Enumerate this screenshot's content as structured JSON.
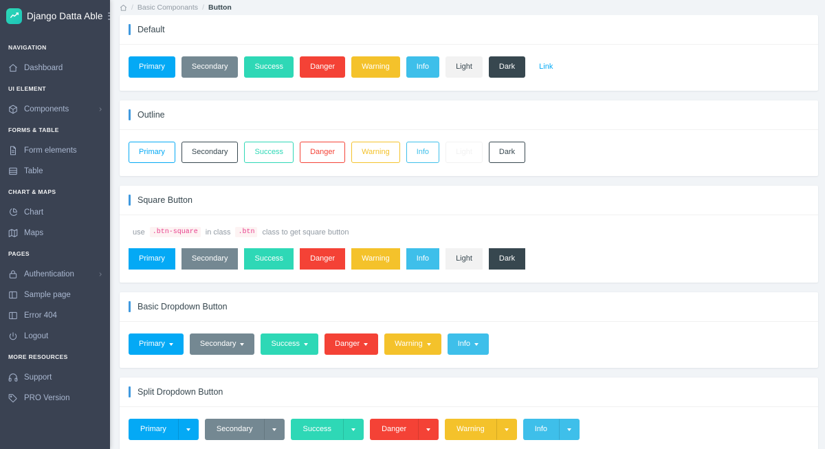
{
  "sidebar": {
    "brand": "Django Datta Able",
    "logo_icon": "trending-up-icon",
    "toggle_icon": "menu-toggle-icon",
    "groups": [
      {
        "caption": "NAVIGATION",
        "items": [
          {
            "label": "Dashboard",
            "icon": "home-icon",
            "has_arrow": false
          }
        ]
      },
      {
        "caption": "UI ELEMENT",
        "items": [
          {
            "label": "Components",
            "icon": "box-icon",
            "has_arrow": true
          }
        ]
      },
      {
        "caption": "FORMS & TABLE",
        "items": [
          {
            "label": "Form elements",
            "icon": "file-text-icon",
            "has_arrow": false
          },
          {
            "label": "Table",
            "icon": "table-icon",
            "has_arrow": false
          }
        ]
      },
      {
        "caption": "CHART & MAPS",
        "items": [
          {
            "label": "Chart",
            "icon": "pie-chart-icon",
            "has_arrow": false
          },
          {
            "label": "Maps",
            "icon": "map-icon",
            "has_arrow": false
          }
        ]
      },
      {
        "caption": "PAGES",
        "items": [
          {
            "label": "Authentication",
            "icon": "lock-icon",
            "has_arrow": true
          },
          {
            "label": "Sample page",
            "icon": "sidebar-page-icon",
            "has_arrow": false
          },
          {
            "label": "Error 404",
            "icon": "sidebar-page-icon",
            "has_arrow": false
          },
          {
            "label": "Logout",
            "icon": "power-icon",
            "has_arrow": false
          }
        ]
      },
      {
        "caption": "MORE RESOURCES",
        "items": [
          {
            "label": "Support",
            "icon": "headphones-icon",
            "has_arrow": false
          },
          {
            "label": "PRO Version",
            "icon": "tag-icon",
            "has_arrow": false
          }
        ]
      }
    ]
  },
  "breadcrumb": {
    "home_icon": "home-icon",
    "separator": "/",
    "parent": "Basic Componants",
    "current": "Button"
  },
  "sections": {
    "default": {
      "title": "Default",
      "buttons": [
        {
          "label": "Primary",
          "variant": "primary"
        },
        {
          "label": "Secondary",
          "variant": "secondary"
        },
        {
          "label": "Success",
          "variant": "success"
        },
        {
          "label": "Danger",
          "variant": "danger"
        },
        {
          "label": "Warning",
          "variant": "warning"
        },
        {
          "label": "Info",
          "variant": "info"
        },
        {
          "label": "Light",
          "variant": "light"
        },
        {
          "label": "Dark",
          "variant": "dark"
        },
        {
          "label": "Link",
          "variant": "link"
        }
      ]
    },
    "outline": {
      "title": "Outline",
      "buttons": [
        {
          "label": "Primary",
          "variant": "primary"
        },
        {
          "label": "Secondary",
          "variant": "secondary"
        },
        {
          "label": "Success",
          "variant": "success"
        },
        {
          "label": "Danger",
          "variant": "danger"
        },
        {
          "label": "Warning",
          "variant": "warning"
        },
        {
          "label": "Info",
          "variant": "info"
        },
        {
          "label": "Light",
          "variant": "light"
        },
        {
          "label": "Dark",
          "variant": "dark"
        }
      ]
    },
    "square": {
      "title": "Square Button",
      "note": {
        "pre": "use",
        "code1": ".btn-square",
        "mid": "in class",
        "code2": ".btn",
        "post": "class to get square button"
      },
      "buttons": [
        {
          "label": "Primary",
          "variant": "primary"
        },
        {
          "label": "Secondary",
          "variant": "secondary"
        },
        {
          "label": "Success",
          "variant": "success"
        },
        {
          "label": "Danger",
          "variant": "danger"
        },
        {
          "label": "Warning",
          "variant": "warning"
        },
        {
          "label": "Info",
          "variant": "info"
        },
        {
          "label": "Light",
          "variant": "light"
        },
        {
          "label": "Dark",
          "variant": "dark"
        }
      ]
    },
    "basic_dropdown": {
      "title": "Basic Dropdown Button",
      "buttons": [
        {
          "label": "Primary",
          "variant": "primary"
        },
        {
          "label": "Secondary",
          "variant": "secondary"
        },
        {
          "label": "Success",
          "variant": "success"
        },
        {
          "label": "Danger",
          "variant": "danger"
        },
        {
          "label": "Warning",
          "variant": "warning"
        },
        {
          "label": "Info",
          "variant": "info"
        }
      ]
    },
    "split_dropdown": {
      "title": "Split Dropdown Button",
      "buttons": [
        {
          "label": "Primary",
          "variant": "primary"
        },
        {
          "label": "Secondary",
          "variant": "secondary"
        },
        {
          "label": "Success",
          "variant": "success"
        },
        {
          "label": "Danger",
          "variant": "danger"
        },
        {
          "label": "Warning",
          "variant": "warning"
        },
        {
          "label": "Info",
          "variant": "info"
        }
      ]
    }
  },
  "colors": {
    "primary": "#04a9f5",
    "secondary": "#748892",
    "success": "#2ed8b6",
    "danger": "#f44236",
    "warning": "#f4c22b",
    "info": "#3ebfea",
    "light": "#f2f2f2",
    "dark": "#37474f",
    "accent_bar": "#4099de",
    "sidebar_bg": "#3a4252",
    "page_bg": "#f1f4f7"
  }
}
